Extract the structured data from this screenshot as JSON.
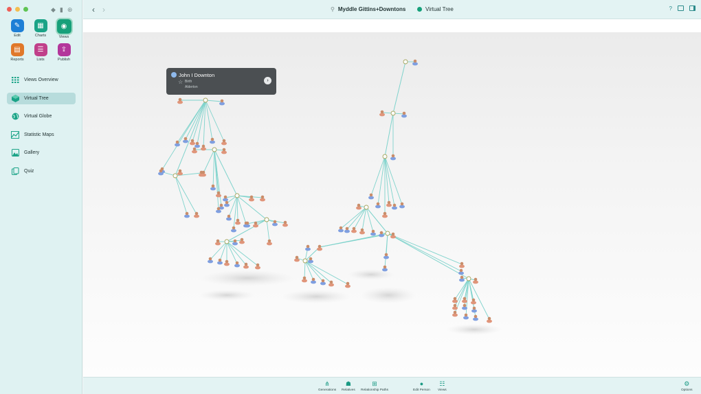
{
  "window": {
    "doc_title": "Myddle Gittins+Downtons",
    "view_title": "Virtual Tree"
  },
  "apps": [
    {
      "label": "Edit",
      "icon": "pencil-icon"
    },
    {
      "label": "Charts",
      "icon": "charts-icon"
    },
    {
      "label": "Views",
      "icon": "eye-icon"
    },
    {
      "label": "Reports",
      "icon": "reports-icon"
    },
    {
      "label": "Lists",
      "icon": "lists-icon"
    },
    {
      "label": "Publish",
      "icon": "publish-icon"
    }
  ],
  "nav": [
    {
      "label": "Views Overview",
      "icon": "grid-icon"
    },
    {
      "label": "Virtual Tree",
      "icon": "cube-icon"
    },
    {
      "label": "Virtual Globe",
      "icon": "globe-icon"
    },
    {
      "label": "Statistic Maps",
      "icon": "map-icon"
    },
    {
      "label": "Gallery",
      "icon": "gallery-icon"
    },
    {
      "label": "Quiz",
      "icon": "quiz-icon"
    }
  ],
  "active_nav": "Virtual Tree",
  "popover": {
    "name": "John  I Downton",
    "event": "Birth",
    "place": "Alderton"
  },
  "bottom": [
    {
      "label": "Generations",
      "icon": "generations-icon"
    },
    {
      "label": "Relatives",
      "icon": "relatives-icon"
    },
    {
      "label": "Relationship Paths",
      "icon": "paths-icon"
    },
    {
      "label": "Edit Person",
      "icon": "person-icon"
    },
    {
      "label": "Views",
      "icon": "views-icon"
    },
    {
      "label": "Options",
      "icon": "gear-icon"
    }
  ],
  "colors": {
    "accent": "#1aa387",
    "tree_line": "#7fd3cc",
    "male": "#7f9fe0",
    "female": "#e0957a"
  }
}
